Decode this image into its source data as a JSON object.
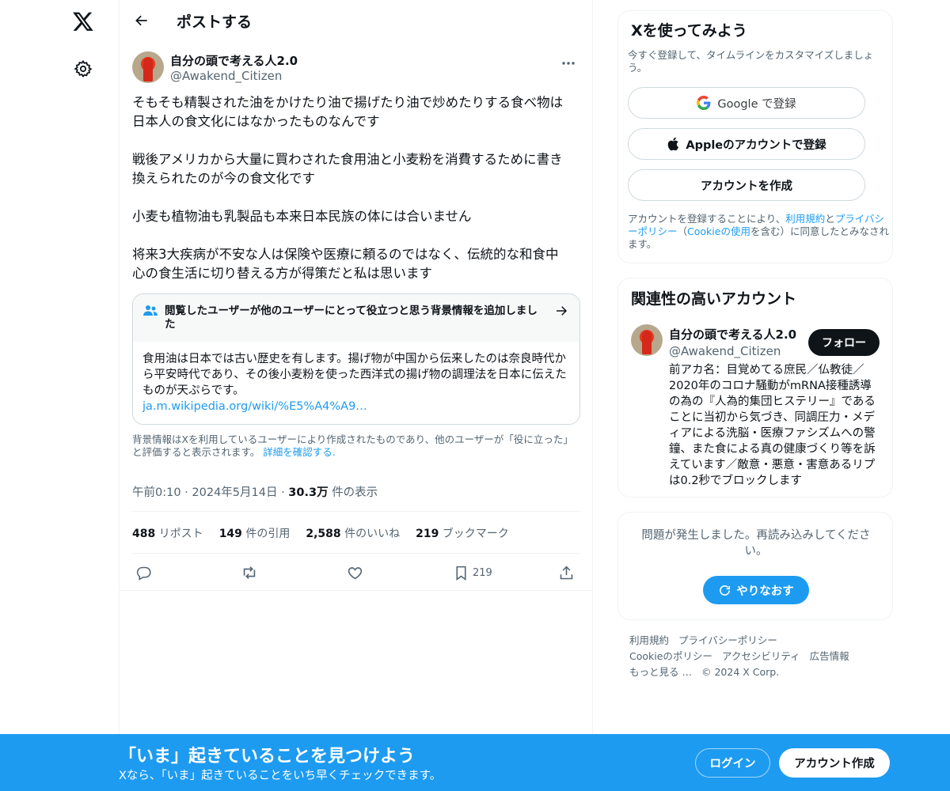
{
  "nav": {
    "logo_icon": "x-logo-icon",
    "settings_icon": "gear-icon"
  },
  "header": {
    "title": "ポストする"
  },
  "post": {
    "author_name": "自分の頭で考える人2.0",
    "author_handle": "@Awakend_Citizen",
    "paragraphs": [
      "そもそも精製された油をかけたり油で揚げたり油で炒めたりする食べ物は\n日本人の食文化にはなかったものなんです",
      "戦後アメリカから大量に買わされた食用油と小麦粉を消費するために書き\n換えられたのが今の食文化です",
      "小麦も植物油も乳製品も本来日本民族の体には合いません",
      "将来3大疾病が不安な人は保険や医療に頼るのではなく、伝統的な和食中\n心の食生活に切り替える方が得策だと私は思います"
    ],
    "note": {
      "title": "閲覧したユーザーが他のユーザーにとって役立つと思う背景情報を追加しました",
      "body": "食用油は日本では古い歴史を有します。揚げ物が中国から伝来したのは奈良時代から平安時代であり、その後小麦粉を使った西洋式の揚げ物の調理法を日本に伝えたものが天ぷらです。",
      "link": "ja.m.wikipedia.org/wiki/%E5%A4%A9…"
    },
    "note_footer": "背景情報はXを利用しているユーザーにより作成されたものであり、他のユーザーが「役に立った」と評価すると表示されます。",
    "note_footer_link": "詳細を確認する.",
    "time": "午前0:10",
    "date": "2024年5月14日",
    "views_count": "30.3万",
    "views_label": "件の表示",
    "stats": {
      "reposts": "488",
      "reposts_label": "リポスト",
      "quotes": "149",
      "quotes_label": "件の引用",
      "likes": "2,588",
      "likes_label": "件のいいね",
      "bookmarks": "219",
      "bookmarks_label": "ブックマーク"
    },
    "bookmark_count": "219"
  },
  "signup_card": {
    "title": "Xを使ってみよう",
    "subtitle": "今すぐ登録して、タイムラインをカスタマイズしましょう。",
    "google": "Google で登録",
    "apple": "Appleのアカウントで登録",
    "create": "アカウントを作成",
    "terms_a": "アカウントを登録することにより、",
    "terms_link1": "利用規約",
    "terms_and": "と",
    "terms_link2": "プライバシーポリシー",
    "terms_b": "（",
    "terms_link3": "Cookieの使用",
    "terms_c": "を含む）に同意したとみなされます。"
  },
  "related": {
    "title": "関連性の高いアカウント",
    "name": "自分の頭で考える人2.0",
    "handle": "@Awakend_Citizen",
    "follow": "フォロー",
    "bio": "前アカ名：目覚めてる庶民／仏教徒／2020年のコロナ騒動がmRNA接種誘導の為の『人為的集団ヒステリー』であることに当初から気づき、同調圧力・メディアによる洗脳・医療ファシズムへの警鐘、また食による真の健康づくり等を訴えています／敵意・悪意・害意あるリプは0.2秒でブロックします"
  },
  "error_card": {
    "message": "問題が発生しました。再読み込みしてください。",
    "retry": "やりなおす"
  },
  "footer": {
    "links": [
      "利用規約",
      "プライバシーポリシー",
      "Cookieのポリシー",
      "アクセシビリティ",
      "広告情報",
      "もっと見る …"
    ],
    "copyright": "© 2024 X Corp."
  },
  "bottom_bar": {
    "title": "「いま」起きていることを見つけよう",
    "subtitle": "Xなら、「いま」起きていることをいち早くチェックできます。",
    "login": "ログイン",
    "signup": "アカウント作成"
  },
  "colors": {
    "accent": "#1d9bf0",
    "text": "#0f1419",
    "muted": "#536471",
    "border": "#eff3f4"
  }
}
